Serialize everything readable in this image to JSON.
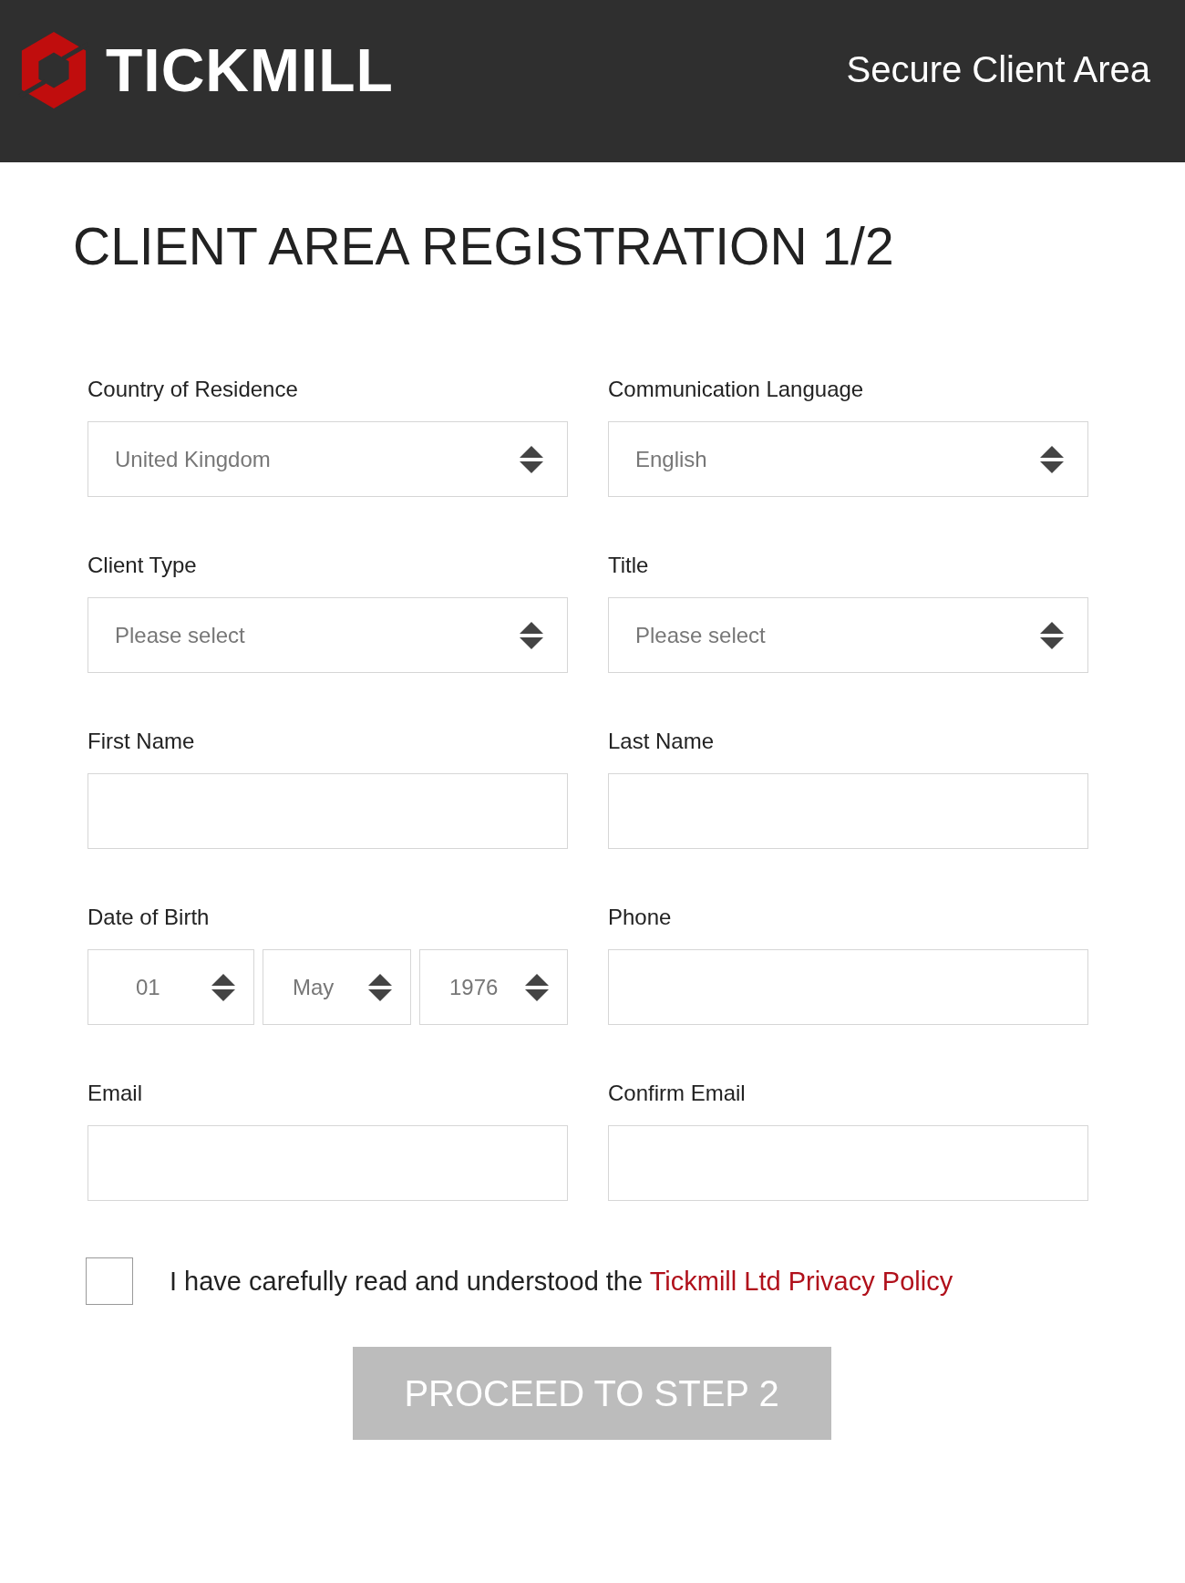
{
  "header": {
    "logo_text": "TICKMILL",
    "title": "Secure Client Area"
  },
  "heading": "CLIENT AREA REGISTRATION 1/2",
  "fields": [
    {
      "label": "Country of Residence",
      "kind": "select",
      "value": "United Kingdom"
    },
    {
      "label": "Communication Language",
      "kind": "select",
      "value": "English"
    },
    {
      "label": "Client Type",
      "kind": "select",
      "value": "Please select"
    },
    {
      "label": "Title",
      "kind": "select",
      "value": "Please select"
    },
    {
      "label": "First Name",
      "kind": "text"
    },
    {
      "label": "Last Name",
      "kind": "text"
    },
    {
      "label": "Date of Birth",
      "kind": "date",
      "parts": [
        "01",
        "May",
        "1976"
      ]
    },
    {
      "label": "Phone",
      "kind": "text"
    },
    {
      "label": "Email",
      "kind": "text"
    },
    {
      "label": "Confirm Email",
      "kind": "text"
    }
  ],
  "consent": {
    "checked": false,
    "text": "I have carefully read and understood the ",
    "link": "Tickmill Ltd Privacy Policy"
  },
  "submit": {
    "label": "PROCEED TO STEP 2",
    "disabled": true
  }
}
